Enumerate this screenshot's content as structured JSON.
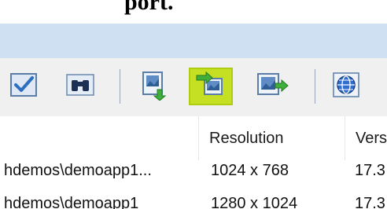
{
  "window": {
    "title_fragment": "port."
  },
  "toolbar": {
    "buttons": [
      {
        "icon": "check-document-icon",
        "active": false
      },
      {
        "icon": "binoculars-icon",
        "active": false
      },
      {
        "icon": "image-import-icon",
        "active": false
      },
      {
        "icon": "image-swap-icon",
        "active": true
      },
      {
        "icon": "image-export-icon",
        "active": false
      },
      {
        "icon": "globe-icon",
        "active": false
      }
    ],
    "highlight_color": "#c5e022"
  },
  "table": {
    "columns": [
      {
        "label": ""
      },
      {
        "label": "Resolution"
      },
      {
        "label": "Vers"
      }
    ],
    "rows": [
      {
        "path": "hdemos\\demoapp1...",
        "resolution": "1024 x 768",
        "version": "17.3"
      },
      {
        "path": "hdemos\\demoapp1",
        "resolution": "1280 x 1024",
        "version": "17.3"
      }
    ]
  }
}
